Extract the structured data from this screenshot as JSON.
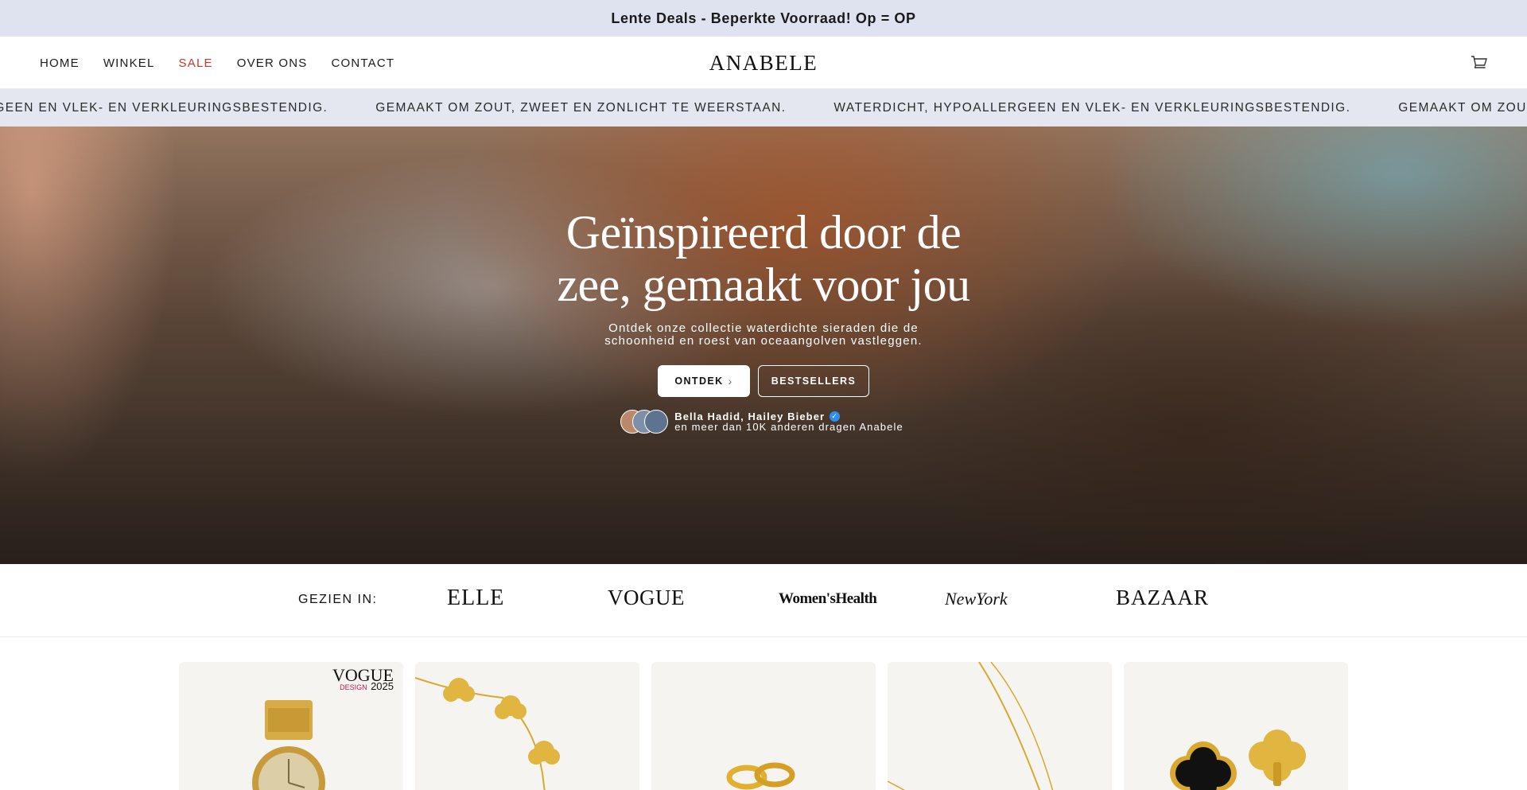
{
  "announcement": "Lente Deals - Beperkte Voorraad! Op = OP",
  "nav": {
    "home": "HOME",
    "shop": "WINKEL",
    "sale": "SALE",
    "about": "OVER ONS",
    "contact": "CONTACT"
  },
  "brand": "ANABELE",
  "marquee": [
    "POALLERGEEN EN VLEK- EN VERKLEURINGSBESTENDIG.",
    "GEMAAKT OM ZOUT, ZWEET EN ZONLICHT TE WEERSTAAN.",
    "WATERDICHT, HYPOALLERGEEN EN VLEK- EN VERKLEURINGSBESTENDIG.",
    "GEMAAKT OM ZOUT, ZWEET EN ZONLICHT TE WEERSTAAN."
  ],
  "hero": {
    "title": "Geïnspireerd door de zee, gemaakt voor jou",
    "subtitle": "Ontdek onze collectie waterdichte sieraden die de schoonheid en roest van oceaangolven vastleggen.",
    "primary_button": "ONTDEK",
    "primary_chevron": "›",
    "secondary_button": "BESTSELLERS",
    "social_names": "Bella Hadid, Hailey Bieber",
    "social_more": "en meer dan 10K anderen dragen Anabele"
  },
  "press": {
    "label": "GEZIEN IN:",
    "logos": [
      "ELLE",
      "VOGUE",
      "Women'sHealth",
      "NewYork",
      "BAZAAR"
    ]
  },
  "badge": {
    "vogue": "VOGUE",
    "design": "DESIGN",
    "year": "2025"
  },
  "colors": {
    "announcement_bg": "#dfe3ef",
    "sale": "#c0392b",
    "marquee_bg": "#e4e7f0",
    "card_bg": "#f6f4f0",
    "gold": "#d9a92f"
  },
  "icons": [
    "cart-icon",
    "chevron-right-icon",
    "verified-icon"
  ]
}
